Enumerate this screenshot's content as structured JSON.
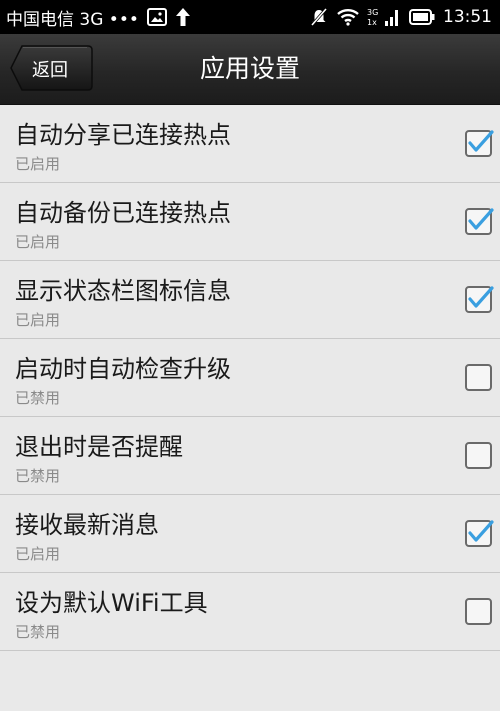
{
  "status_bar": {
    "carrier": "中国电信 3G •••",
    "network_top": "3G",
    "network_bottom": "1x",
    "time": "13:51"
  },
  "header": {
    "back_label": "返回",
    "title": "应用设置"
  },
  "settings": [
    {
      "title": "自动分享已连接热点",
      "status": "已启用",
      "checked": true
    },
    {
      "title": "自动备份已连接热点",
      "status": "已启用",
      "checked": true
    },
    {
      "title": "显示状态栏图标信息",
      "status": "已启用",
      "checked": true
    },
    {
      "title": "启动时自动检查升级",
      "status": "已禁用",
      "checked": false
    },
    {
      "title": "退出时是否提醒",
      "status": "已禁用",
      "checked": false
    },
    {
      "title": "接收最新消息",
      "status": "已启用",
      "checked": true
    },
    {
      "title": "设为默认WiFi工具",
      "status": "已禁用",
      "checked": false
    }
  ],
  "colors": {
    "check_mark": "#3a9fe0",
    "row_background": "#e9e9e9",
    "header_background": "#262626"
  }
}
